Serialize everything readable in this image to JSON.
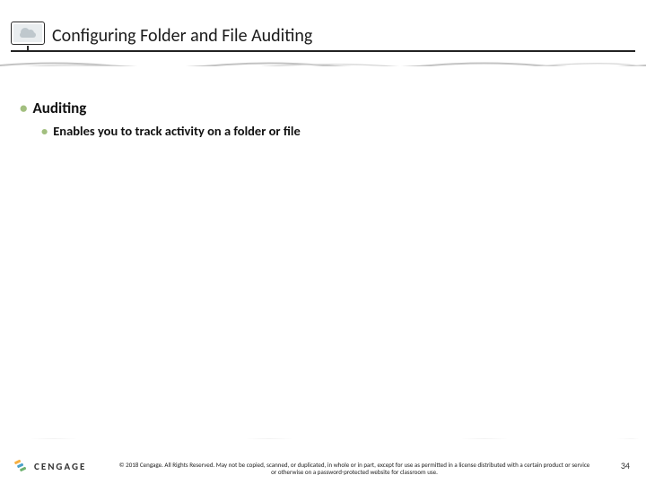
{
  "header": {
    "title": "Configuring Folder and File Auditing",
    "icon": "monitor-cloud-icon"
  },
  "body": {
    "bullets": [
      {
        "level": 1,
        "text": "Auditing"
      },
      {
        "level": 2,
        "text": "Enables you to track activity on a folder or file"
      }
    ]
  },
  "footer": {
    "logo_text": "CENGAGE",
    "copyright": "© 2018 Cengage. All Rights Reserved. May not be copied, scanned, or duplicated, in whole or in part, except for use as permitted in a license distributed with a certain product or service or otherwise on a password-protected website for classroom use.",
    "page_number": "34"
  }
}
